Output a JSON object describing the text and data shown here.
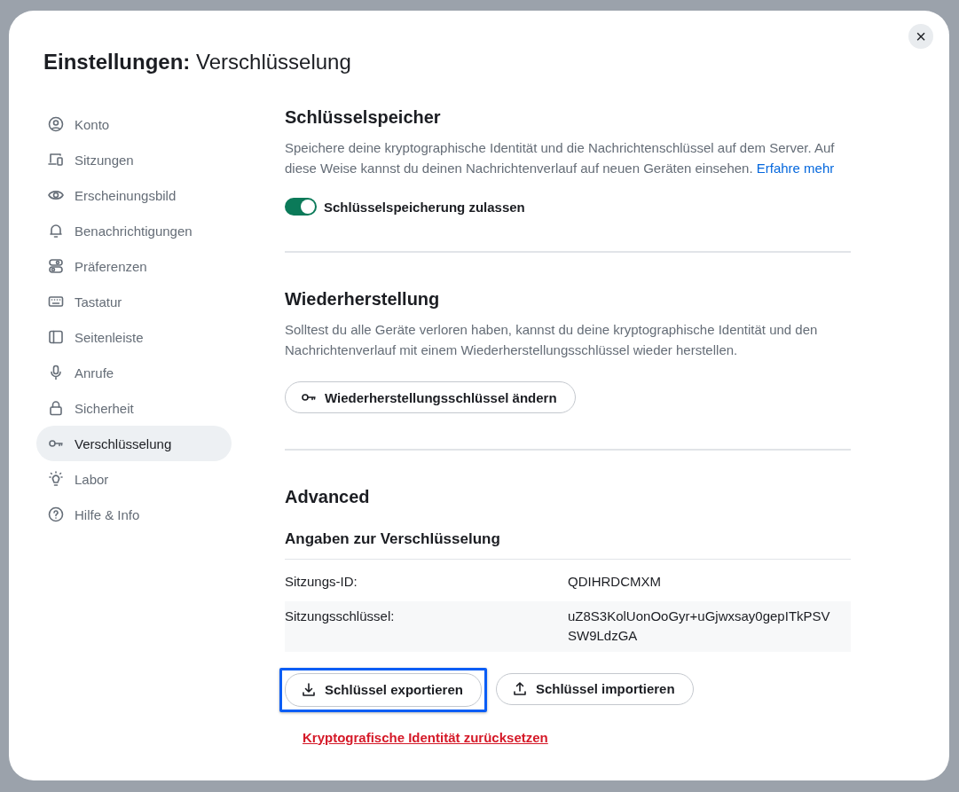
{
  "dialog": {
    "title": "**Einstellungen:** Verschlüsselung",
    "close": "×"
  },
  "sidebar": {
    "items": [
      {
        "label": "Konto",
        "selected": false
      },
      {
        "label": "Sitzungen",
        "selected": false
      },
      {
        "label": "Erscheinungsbild",
        "selected": false
      },
      {
        "label": "Benachrichtigungen",
        "selected": false
      },
      {
        "label": "Präferenzen",
        "selected": false
      },
      {
        "label": "Tastatur",
        "selected": false
      },
      {
        "label": "Seitenleiste",
        "selected": false
      },
      {
        "label": "Anrufe",
        "selected": false
      },
      {
        "label": "Sicherheit",
        "selected": false
      },
      {
        "label": "Verschlüsselung",
        "selected": true
      },
      {
        "label": "Labor",
        "selected": false
      },
      {
        "label": "Hilfe & Info",
        "selected": false
      }
    ]
  },
  "key_storage": {
    "heading": "Schlüsselspeicher",
    "description": "Speichere deine kryptographische Identität und die Nachrichtenschlüssel auf dem Server. Auf diese Weise kannst du deinen Nachrichtenverlauf auf neuen Geräten einsehen.",
    "link": "Erfahre mehr",
    "toggle": {
      "label": "Schlüsselspeicherung zulassen",
      "on": true
    }
  },
  "recovery": {
    "heading": "Wiederherstellung",
    "description": "Solltest du alle Geräte verloren haben, kannst du deine kryptographische Identität und den Nachrichtenverlauf mit einem Wiederherstellungsschlüssel wieder herstellen.",
    "button": "Wiederherstellungsschlüssel ändern"
  },
  "advanced": {
    "heading": "Advanced",
    "subheading": "Angaben zur Verschlüsselung",
    "rows": [
      {
        "label": "Sitzungs-ID:",
        "value": "QDIHRDCMXM"
      },
      {
        "label": "Sitzungsschlüssel:",
        "value": "uZ8S3KolUonOoGyr+uGjwxsay0gepITkPSVSW9LdzGA"
      }
    ],
    "buttons": [
      {
        "label": "Schlüssel exportieren",
        "kind": "export",
        "focused": true
      },
      {
        "label": "Schlüssel importieren",
        "kind": "import",
        "focused": false
      }
    ],
    "reset_link": "Kryptografische Identität zurücksetzen"
  }
}
